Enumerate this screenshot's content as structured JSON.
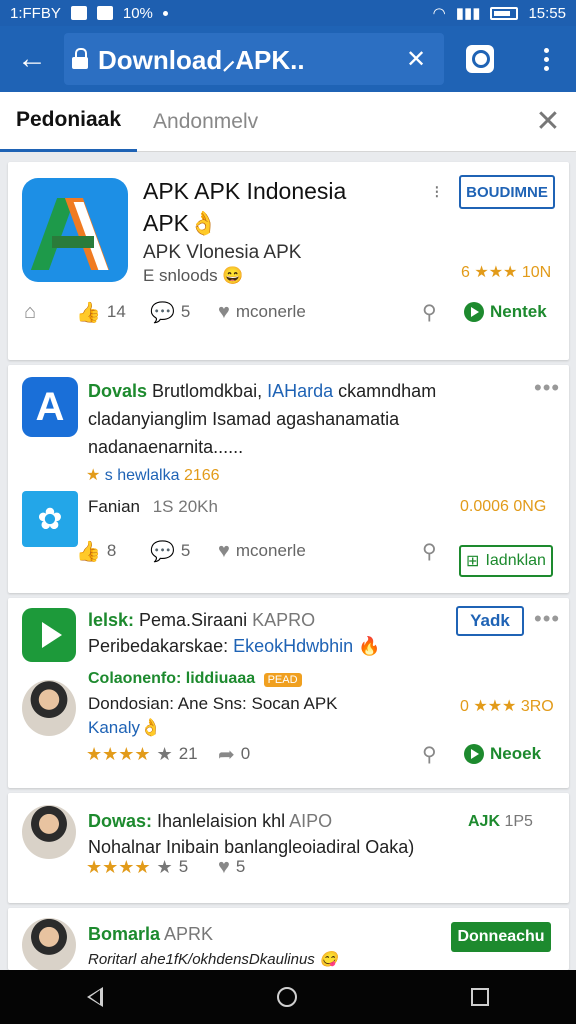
{
  "status_bar": {
    "left_text": "1:FFBY",
    "signal_text": "10%",
    "time": "15:55"
  },
  "toolbar": {
    "back_icon": "arrow-left-icon",
    "url": "Download⸝APK..",
    "url_close": "✕"
  },
  "tabs": [
    {
      "label": "Pedoniaak"
    },
    {
      "label": "Andonmelv"
    }
  ],
  "cards": {
    "c1": {
      "title_line1": "APK APK Indonesia",
      "title_line2": "APK👌",
      "subtitle": "APK Vlonesia APK",
      "meta": "Ε snloods 😄",
      "rating": "6 ★★★ 10N",
      "button": "BOUDIMNE",
      "likes": "14",
      "comments": "5",
      "hearts": "mconerle",
      "action_button": "Nentek"
    },
    "c2": {
      "line1_green": "Dovals",
      "line1_rest": " Brutlomdkbai, ",
      "line1_blue": "IAHarda",
      "line1_tail": " ckamndham",
      "line2": "cladanyianglim Isamad agashanamatia",
      "line3": "nadanaenarnita......",
      "rating_text": "s hewlalka",
      "rating_num": "2166",
      "sub_name": "Fanian",
      "sub_meta": "1S 20Kh",
      "sub_rating": "0.0006 0NG",
      "likes": "8",
      "comments": "5",
      "hearts": "mconerle",
      "action_button": "Iadnklan"
    },
    "c3": {
      "line1_green": "lelsk:",
      "line1_rest": " Pema.Siraani",
      "line1_grey": " KAPRO",
      "line2_start": "Peribedakarskae: ",
      "line2_blue": "EkeokHdwbhin",
      "line2_emoji": " 🔥",
      "tag_line": "Colaonenfo: liddiuaaa",
      "tag_badge": "PEAD",
      "person_line1": "Dondosian: Ane Sns: Socan APK",
      "person_line2": "Kanaly👌",
      "person_rating": "0 ★★★ 3RO",
      "button": "Yadk",
      "stars_count": "21",
      "comments": "0",
      "action_button": "Neoek"
    },
    "c4": {
      "line1_green": "Dowas:",
      "line1_rest": " Ihanlelaision khl",
      "line1_grey": " AIPO",
      "line2": "Nohalnar Inibain banlangleoiadiral Oaka)",
      "right_label": "AJK",
      "right_sub": "1P5",
      "stars_count": "5",
      "comments": "5"
    },
    "c5": {
      "line1_green": "Bomarla",
      "line1_grey": " APRK",
      "line2": "Roritarl ahe1fK/okhdensDkaulinus 😋",
      "button": "Donneachu"
    }
  }
}
